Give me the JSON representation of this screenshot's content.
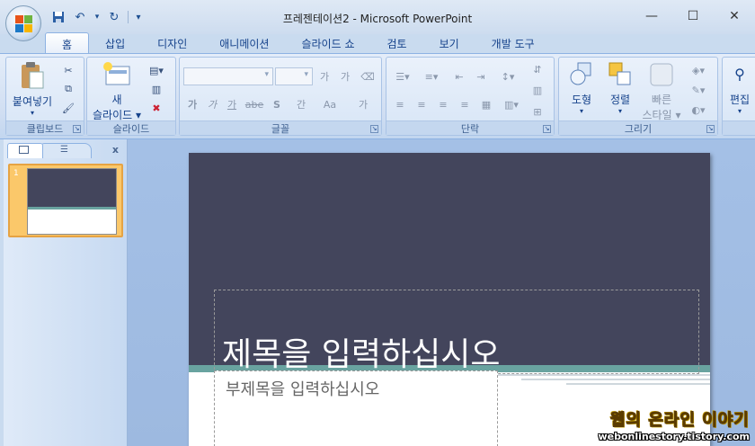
{
  "window": {
    "title": "프레젠테이션2 - Microsoft PowerPoint",
    "minimize_glyph": "—",
    "maximize_glyph": "☐",
    "close_glyph": "✕"
  },
  "quick_access": {
    "save_icon": "save-icon",
    "undo_glyph": "↶",
    "redo_glyph": "↻",
    "customize_glyph": "▾"
  },
  "tabs": [
    "홈",
    "삽입",
    "디자인",
    "애니메이션",
    "슬라이드 쇼",
    "검토",
    "보기",
    "개발 도구"
  ],
  "ribbon": {
    "clipboard": {
      "label": "클립보드",
      "paste": "붙여넣기"
    },
    "slides": {
      "label": "슬라이드",
      "new_slide_1": "새",
      "new_slide_2": "슬라이드"
    },
    "font": {
      "label": "글꼴",
      "grow": "가",
      "shrink": "가",
      "bold": "가",
      "italic": "가",
      "underline": "가",
      "strike": "abe",
      "shadow": "S",
      "spacing": "간",
      "case": "Aa",
      "color": "가"
    },
    "paragraph": {
      "label": "단락"
    },
    "drawing": {
      "label": "그리기",
      "shape": "도형",
      "arrange": "정렬",
      "quick_styles_1": "빠른",
      "quick_styles_2": "스타일"
    },
    "editing": {
      "label": "편집"
    }
  },
  "slides_pane": {
    "close": "x",
    "thumbnail_number": "1"
  },
  "slide": {
    "title_placeholder": "제목을 입력하십시오",
    "subtitle_placeholder": "부제목을 입력하십시오"
  },
  "watermark": {
    "line1": "웹의 온라인 이야기",
    "line2": "webonlinestory.tistory.com"
  },
  "colors": {
    "slide_dark": "#43455c",
    "slide_band": "#69a3a0",
    "ribbon": "#d0def2",
    "thumbnail_selected": "#fbc86a"
  }
}
